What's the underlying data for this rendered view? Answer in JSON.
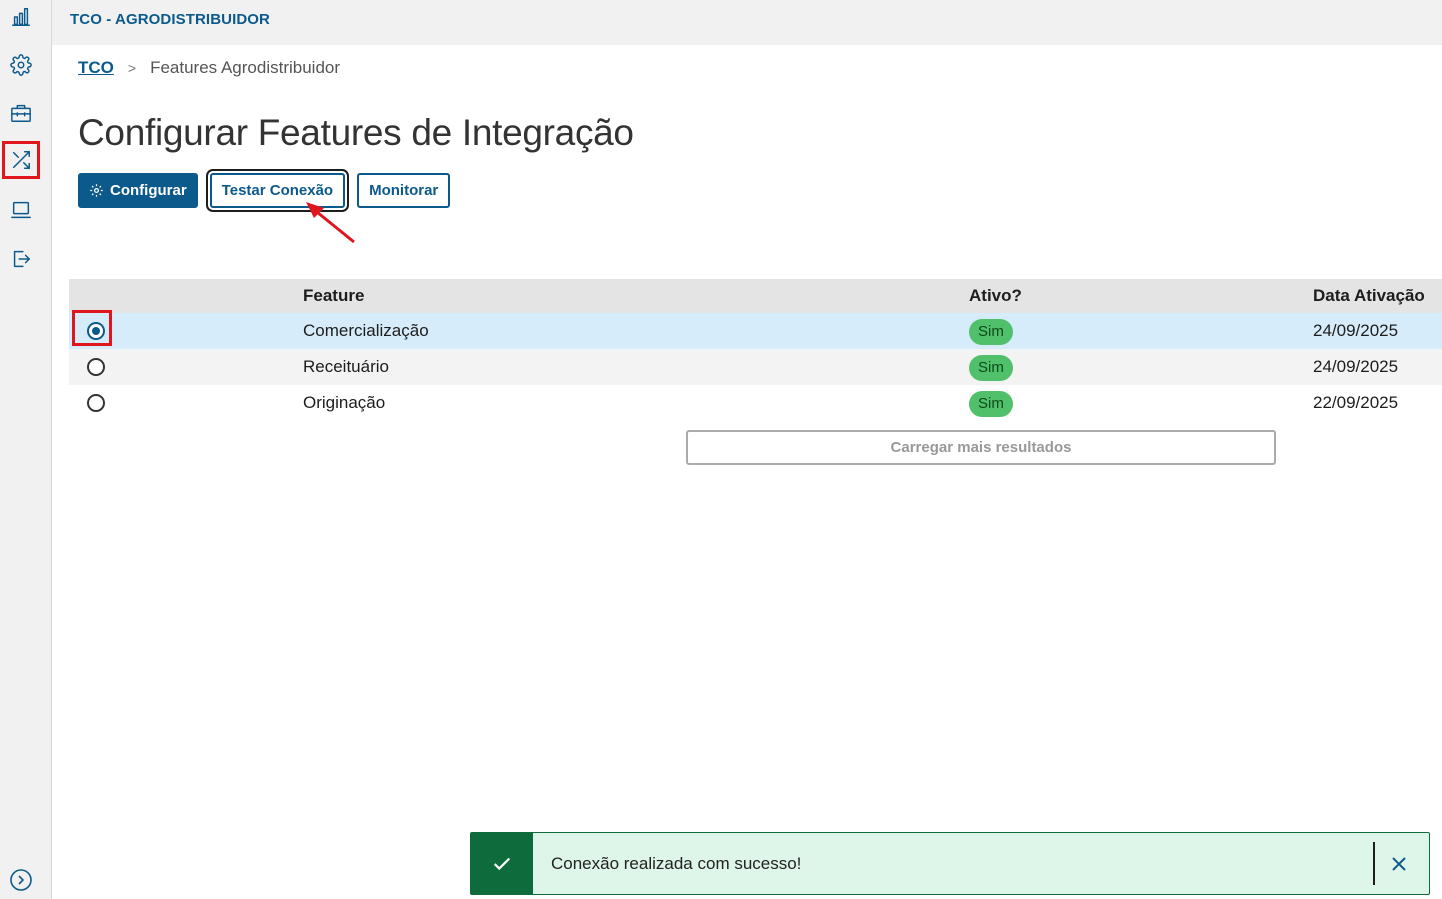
{
  "app": {
    "title": "TCO - AGRODISTRIBUIDOR"
  },
  "sidebar": {
    "items": [
      {
        "icon": "bar-chart-icon"
      },
      {
        "icon": "gear-icon"
      },
      {
        "icon": "briefcase-icon"
      },
      {
        "icon": "shuffle-icon",
        "highlighted": true
      },
      {
        "icon": "laptop-icon"
      },
      {
        "icon": "logout-icon"
      }
    ],
    "expand_icon": "chevron-right-circle-icon"
  },
  "breadcrumb": {
    "root": "TCO",
    "separator": ">",
    "current": "Features Agrodistribuidor"
  },
  "page": {
    "title": "Configurar Features de Integração"
  },
  "toolbar": {
    "configure_label": "Configurar",
    "test_label": "Testar Conexão",
    "monitor_label": "Monitorar"
  },
  "table": {
    "headers": {
      "feature": "Feature",
      "ativo": "Ativo?",
      "data": "Data Ativação"
    },
    "rows": [
      {
        "feature": "Comercialização",
        "ativo": "Sim",
        "data": "24/09/2025",
        "selected": true
      },
      {
        "feature": "Receituário",
        "ativo": "Sim",
        "data": "24/09/2025",
        "selected": false
      },
      {
        "feature": "Originação",
        "ativo": "Sim",
        "data": "22/09/2025",
        "selected": false
      }
    ],
    "load_more_label": "Carregar mais resultados"
  },
  "toast": {
    "message": "Conexão realizada com sucesso!",
    "type": "success"
  },
  "colors": {
    "primary": "#0c5a8c",
    "success": "#0d6b3c",
    "badge": "#50c06a",
    "highlight": "#e0161e"
  }
}
